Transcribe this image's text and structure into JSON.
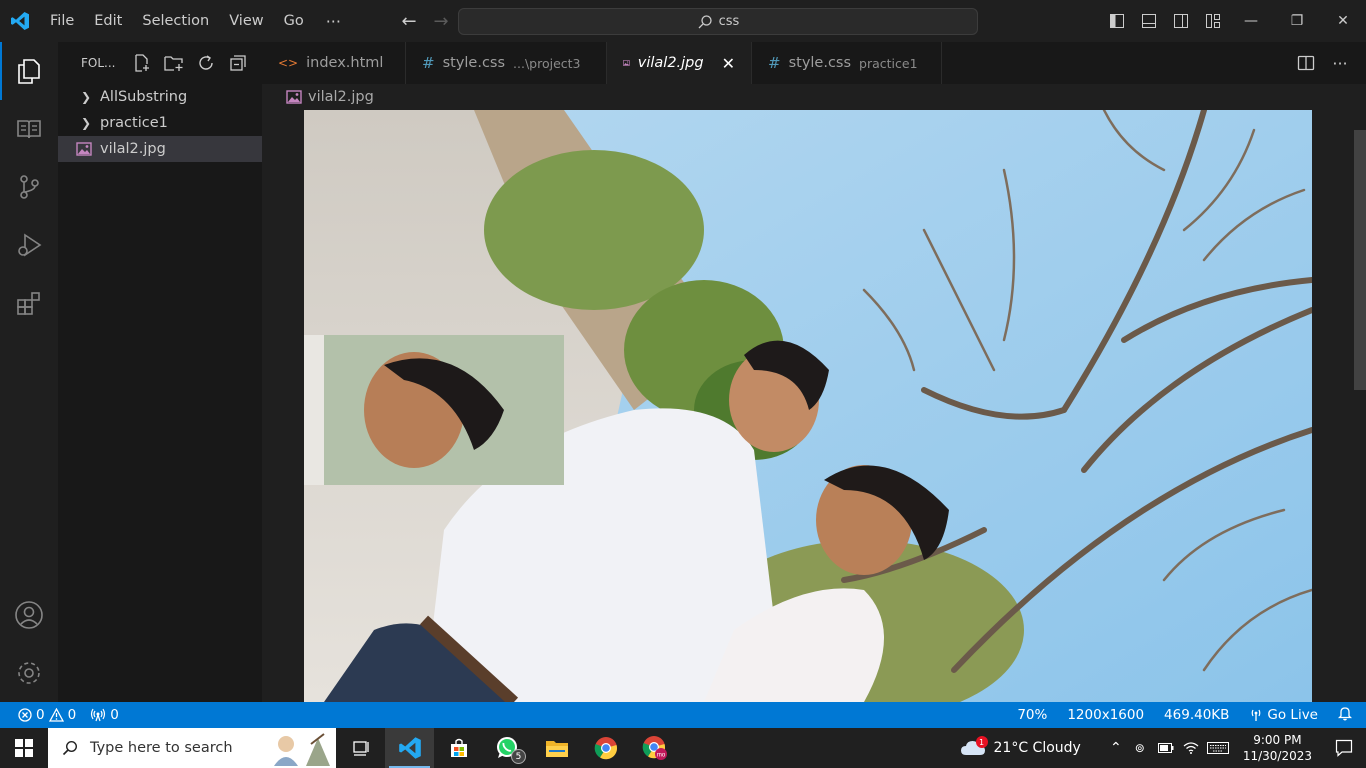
{
  "menu": [
    "File",
    "Edit",
    "Selection",
    "View",
    "Go"
  ],
  "menu_more": "···",
  "search": {
    "text": "css"
  },
  "explorer": {
    "header": "FOL...",
    "items": [
      {
        "label": "AllSubstring",
        "type": "folder"
      },
      {
        "label": "practice1",
        "type": "folder"
      },
      {
        "label": "vilal2.jpg",
        "type": "file",
        "selected": true
      }
    ]
  },
  "tabs": [
    {
      "label": "index.html",
      "desc": "",
      "icon": "html-icon"
    },
    {
      "label": "style.css",
      "desc": "...\\project3",
      "icon": "css-icon"
    },
    {
      "label": "vilal2.jpg",
      "desc": "",
      "icon": "image-icon",
      "active": true
    },
    {
      "label": "style.css",
      "desc": "practice1",
      "icon": "css-icon"
    }
  ],
  "breadcrumb": {
    "file": "vilal2.jpg"
  },
  "status": {
    "errors": "0",
    "warnings": "0",
    "ports": "0",
    "zoom": "70%",
    "dimensions": "1200x1600",
    "size": "469.40KB",
    "go_live": "Go Live"
  },
  "taskbar": {
    "search_placeholder": "Type here to search",
    "whatsapp_badge": "5",
    "weather": "21°C  Cloudy",
    "weather_badge": "1",
    "time": "9:00 PM",
    "date": "11/30/2023"
  },
  "colors": {
    "accent": "#0078d4",
    "statusbar": "#0078d4",
    "image_icon": "#c586c0",
    "css_icon": "#519aba",
    "html_icon": "#e37933"
  }
}
